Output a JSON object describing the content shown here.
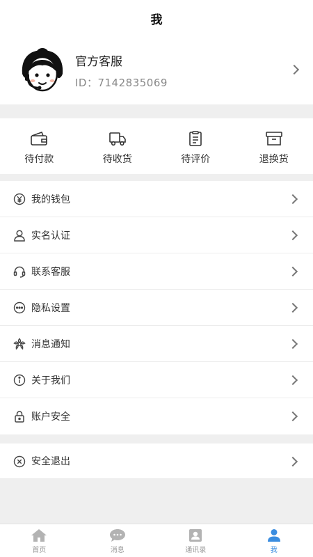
{
  "header": {
    "title": "我"
  },
  "profile": {
    "name": "官方客服",
    "id_text": "ID：7142835069"
  },
  "orders": [
    {
      "label": "待付款",
      "icon": "wallet-icon"
    },
    {
      "label": "待收货",
      "icon": "truck-icon"
    },
    {
      "label": "待评价",
      "icon": "clipboard-icon"
    },
    {
      "label": "退换货",
      "icon": "return-box-icon"
    }
  ],
  "menu": [
    {
      "label": "我的钱包",
      "icon": "yuan-coin-icon"
    },
    {
      "label": "实名认证",
      "icon": "user-icon"
    },
    {
      "label": "联系客服",
      "icon": "headset-icon"
    },
    {
      "label": "隐私设置",
      "icon": "more-dots-icon"
    },
    {
      "label": "消息通知",
      "icon": "flower-icon"
    },
    {
      "label": "关于我们",
      "icon": "info-icon"
    },
    {
      "label": "账户安全",
      "icon": "lock-icon"
    }
  ],
  "logout": {
    "label": "安全退出",
    "icon": "close-circle-icon"
  },
  "tabbar": [
    {
      "label": "首页",
      "icon": "home-icon",
      "active": false
    },
    {
      "label": "消息",
      "icon": "chat-icon",
      "active": false
    },
    {
      "label": "通讯录",
      "icon": "contacts-icon",
      "active": false
    },
    {
      "label": "我",
      "icon": "person-icon",
      "active": true
    }
  ],
  "colors": {
    "accent": "#3a8de0",
    "inactive": "#999999",
    "background": "#efefef"
  }
}
